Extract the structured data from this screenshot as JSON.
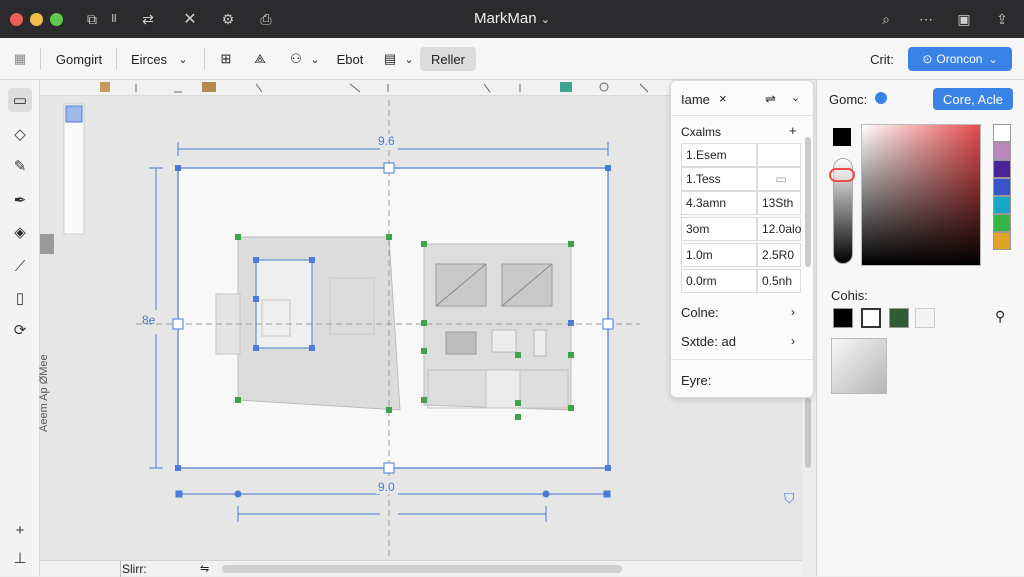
{
  "app": {
    "title": "MarkMan"
  },
  "colors": {
    "accent": "#3b82e6",
    "titlebar": "#2b2b2d",
    "handle": "#3fa34d",
    "guide": "#4b7bd4"
  },
  "toolbar": {
    "items": [
      "Gomgirt",
      "Eirces",
      "Ebot",
      "Reller"
    ],
    "right_label": "Crit:",
    "right_button": "Oroncon"
  },
  "canvas": {
    "dim_top": "9.6",
    "dim_bottom": "9.0",
    "dim_left": "8e",
    "vertical_label": "Aeem Ap ØMee"
  },
  "status": {
    "text": "Slirr:"
  },
  "panel": {
    "header_title": "Iame",
    "header_close": "×",
    "section": "Cxalms",
    "rows": [
      [
        "1.Esem",
        ""
      ],
      [
        "1.Tess",
        ""
      ],
      [
        "4.3amn",
        "13Sth"
      ],
      [
        "3om",
        "12.0alo"
      ],
      [
        "1.0m",
        "2.5R0"
      ],
      [
        "0.0rm",
        "0.5nh"
      ]
    ],
    "links": [
      "Colne:",
      "Sxtde: ad"
    ],
    "footer": "Eyre:"
  },
  "right": {
    "title": "Gomc:",
    "button": "Core, Acle",
    "colors_label": "Cohis:",
    "palette": [
      "#ffffff",
      "#b987ba",
      "#4b2597",
      "#3b54c8",
      "#18a7c9",
      "#35b545",
      "#e1a12a"
    ],
    "swatches": [
      "#000000",
      "#ffffff",
      "#2f5c36",
      "#f3f3f3"
    ]
  }
}
